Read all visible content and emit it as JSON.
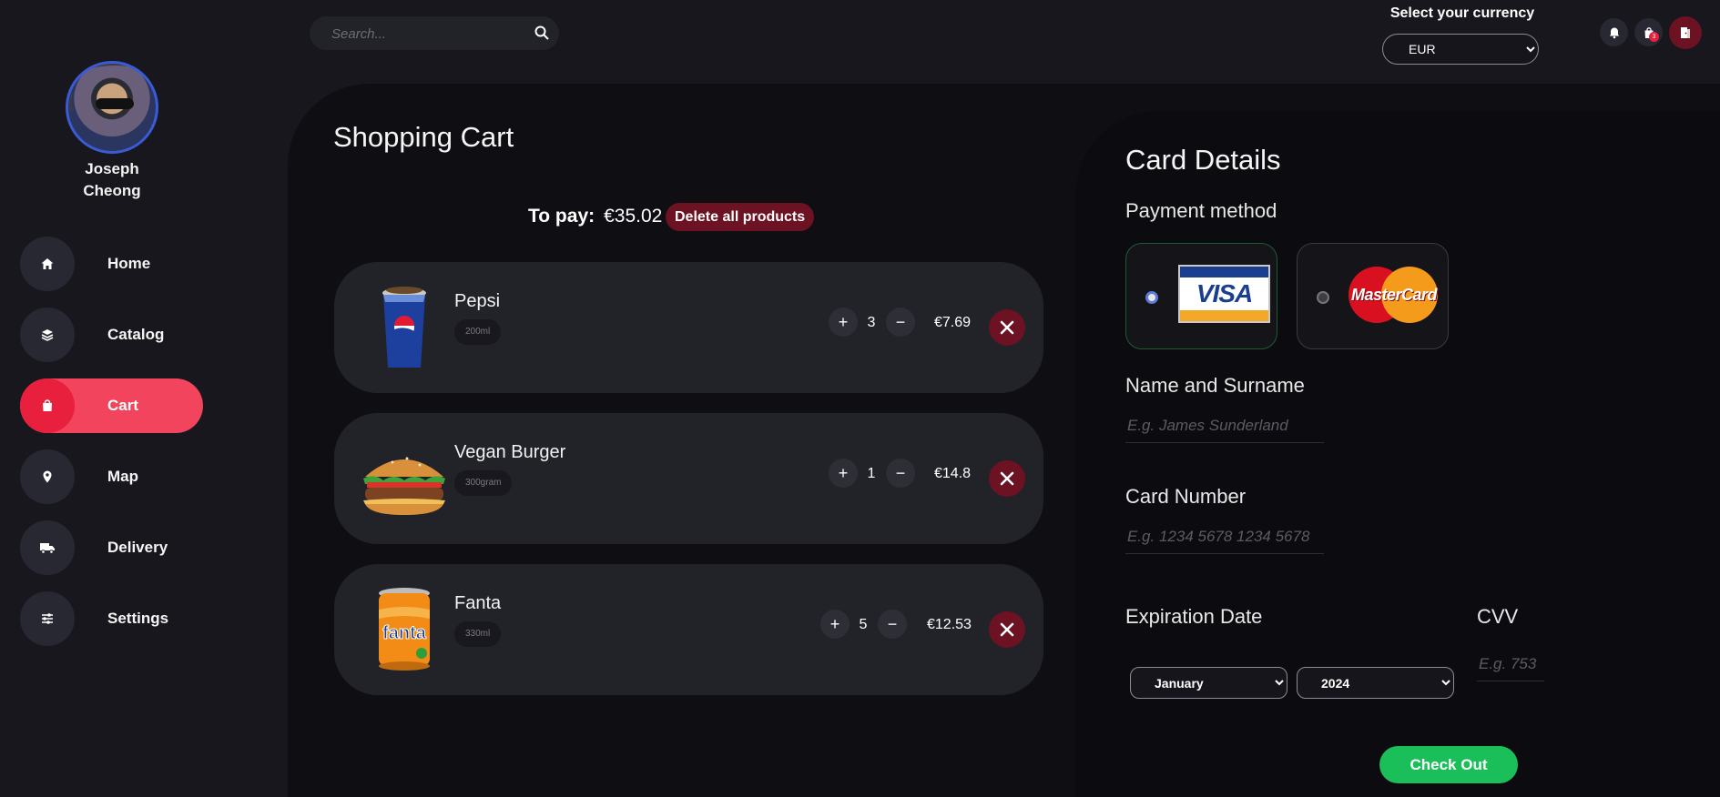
{
  "user": {
    "name": "Joseph Cheong"
  },
  "sidebar": {
    "items": [
      {
        "label": "Home",
        "icon": "home-icon"
      },
      {
        "label": "Catalog",
        "icon": "layers-icon"
      },
      {
        "label": "Cart",
        "icon": "bag-icon",
        "active": true
      },
      {
        "label": "Map",
        "icon": "map-pin-icon"
      },
      {
        "label": "Delivery",
        "icon": "truck-icon"
      },
      {
        "label": "Settings",
        "icon": "sliders-icon"
      }
    ]
  },
  "topbar": {
    "search_placeholder": "Search...",
    "currency_title": "Select your currency",
    "currency_selected": "EUR",
    "cart_badge": "3",
    "icons": [
      "bell-icon",
      "shopping-bag-icon",
      "logout-icon"
    ]
  },
  "cart": {
    "title": "Shopping Cart",
    "to_pay_label": "To pay:",
    "to_pay_amount": "€35.02",
    "delete_all_label": "Delete all products",
    "items": [
      {
        "name": "Pepsi",
        "size": "200ml",
        "qty": "3",
        "price": "€7.69",
        "image": "pepsi-cup-image"
      },
      {
        "name": "Vegan Burger",
        "size": "300gram",
        "qty": "1",
        "price": "€14.8",
        "image": "burger-image"
      },
      {
        "name": "Fanta",
        "size": "330ml",
        "qty": "5",
        "price": "€12.53",
        "image": "fanta-can-image"
      }
    ]
  },
  "card": {
    "title": "Card Details",
    "payment_method_label": "Payment method",
    "methods": [
      {
        "name": "VISA",
        "selected": true
      },
      {
        "name": "MasterCard",
        "selected": false
      }
    ],
    "name_label": "Name and Surname",
    "name_placeholder": "E.g. James Sunderland",
    "number_label": "Card Number",
    "number_placeholder": "E.g. 1234 5678 1234 5678",
    "expiration_label": "Expiration Date",
    "month_selected": "January",
    "year_selected": "2024",
    "cvv_label": "CVV",
    "cvv_placeholder": "E.g. 753",
    "checkout_label": "Check Out"
  },
  "colors": {
    "background": "#17171d",
    "panel": "#0f0f13",
    "accent_red": "#f2455d",
    "dark_red": "#6c1222",
    "checkout_green": "#1bbf5a"
  }
}
